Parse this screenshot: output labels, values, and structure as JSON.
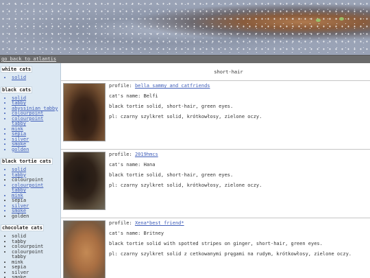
{
  "nav": {
    "back_link": "go back to atlantis"
  },
  "sidebar": {
    "sections": [
      {
        "title": "white cats",
        "items": [
          "solid"
        ]
      },
      {
        "title": "black cats",
        "items": [
          "solid",
          "tabby",
          "abyssinian tabby",
          "colourpoint",
          "colourpoint tabby",
          "mink",
          "sepia",
          "silver",
          "smoke",
          "golden"
        ]
      },
      {
        "title": "black tortie cats",
        "items": [
          "solid",
          "tabby",
          "colourpoint",
          "colourpoint tabby",
          "mink",
          "sepia",
          "silver",
          "smoke",
          "golden"
        ]
      },
      {
        "title": "chocolate cats",
        "items": [
          "solid",
          "tabby",
          "colourpoint",
          "colourpoint tabby",
          "mink",
          "sepia",
          "silver",
          "smoke"
        ]
      }
    ]
  },
  "main": {
    "category_heading": "short-hair",
    "entries": [
      {
        "profile_label": "profile:",
        "profile_link": "bella_sammy_and_catfriends",
        "name_line": "cat's name: Belfi",
        "desc": "black tortie solid, short-hair, green eyes.",
        "pl": "pl: czarny szylkret solid, krótkowłosy, zielone oczy."
      },
      {
        "profile_label": "profile:",
        "profile_link": "2019hmcs",
        "name_line": "cat's name: Hana",
        "desc": "black tortie solid, short-hair, green eyes.",
        "pl": "pl: czarny szylkret solid, krótkowłosy, zielone oczy."
      },
      {
        "profile_label": "profile:",
        "profile_link": "Xena*best friend*",
        "name_line": "cat's name: Britney",
        "desc": "black tortie solid with spotted stripes on ginger, short-hair, green eyes.",
        "pl": "pl: czarny szylkret solid z cetkowanymi pręgami na rudym, krótkowłosy, zielone oczy."
      }
    ]
  },
  "colors": {
    "sidebar_bg": "#dde9f3",
    "nav_bg": "#6b6b6b",
    "link": "#3d5cb8"
  }
}
